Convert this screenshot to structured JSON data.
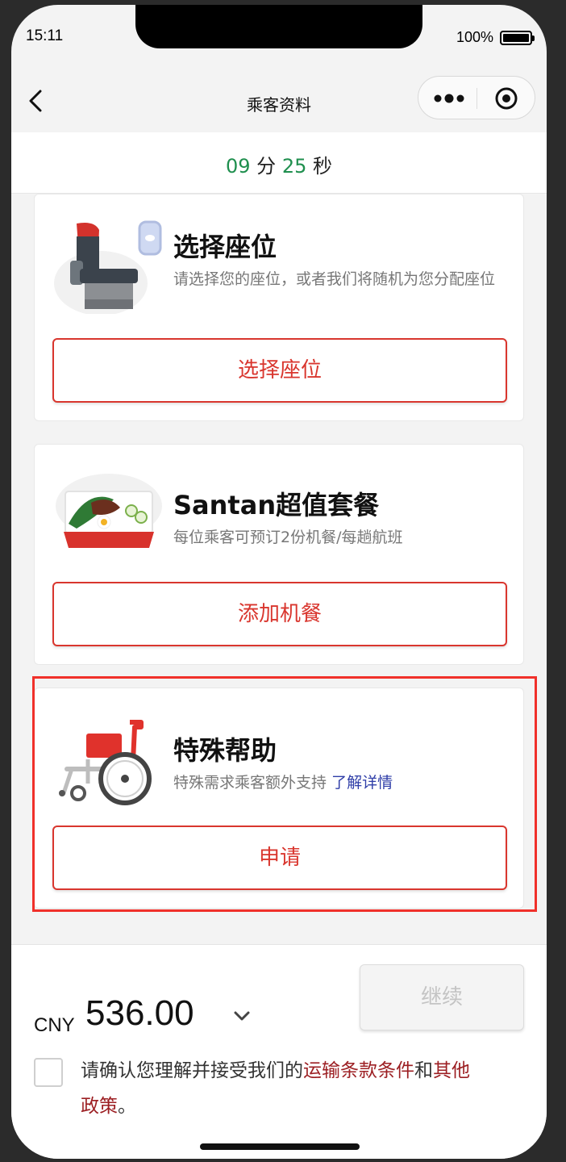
{
  "status_bar": {
    "time": "15:11",
    "battery": "100%"
  },
  "nav": {
    "title": "乘客资料"
  },
  "timer": {
    "minutes": "09",
    "minutes_unit": "分",
    "seconds": "25",
    "seconds_unit": "秒"
  },
  "cards": [
    {
      "title": "选择座位",
      "desc": "请选择您的座位，或者我们将随机为您分配座位",
      "button": "选择座位",
      "icon": "seat-icon"
    },
    {
      "title": "Santan超值套餐",
      "desc": "每位乘客可预订2份机餐/每趟航班",
      "button": "添加机餐",
      "icon": "meal-icon"
    },
    {
      "title": "特殊帮助",
      "desc": "特殊需求乘客额外支持",
      "link": "了解详情",
      "button": "申请",
      "icon": "wheelchair-icon"
    }
  ],
  "footer": {
    "currency": "CNY",
    "price": "536.00",
    "continue_label": "继续",
    "terms_prefix": "请确认您理解并接受我们的",
    "terms_link1": "运输条款条件",
    "terms_mid": "和",
    "terms_link2": "其他政策",
    "terms_suffix": "。"
  },
  "colors": {
    "accent": "#d9362e",
    "timer": "#1f8f4e",
    "link": "#2f3ea8",
    "terms_link": "#9c1f23",
    "highlight": "#f0302a"
  }
}
